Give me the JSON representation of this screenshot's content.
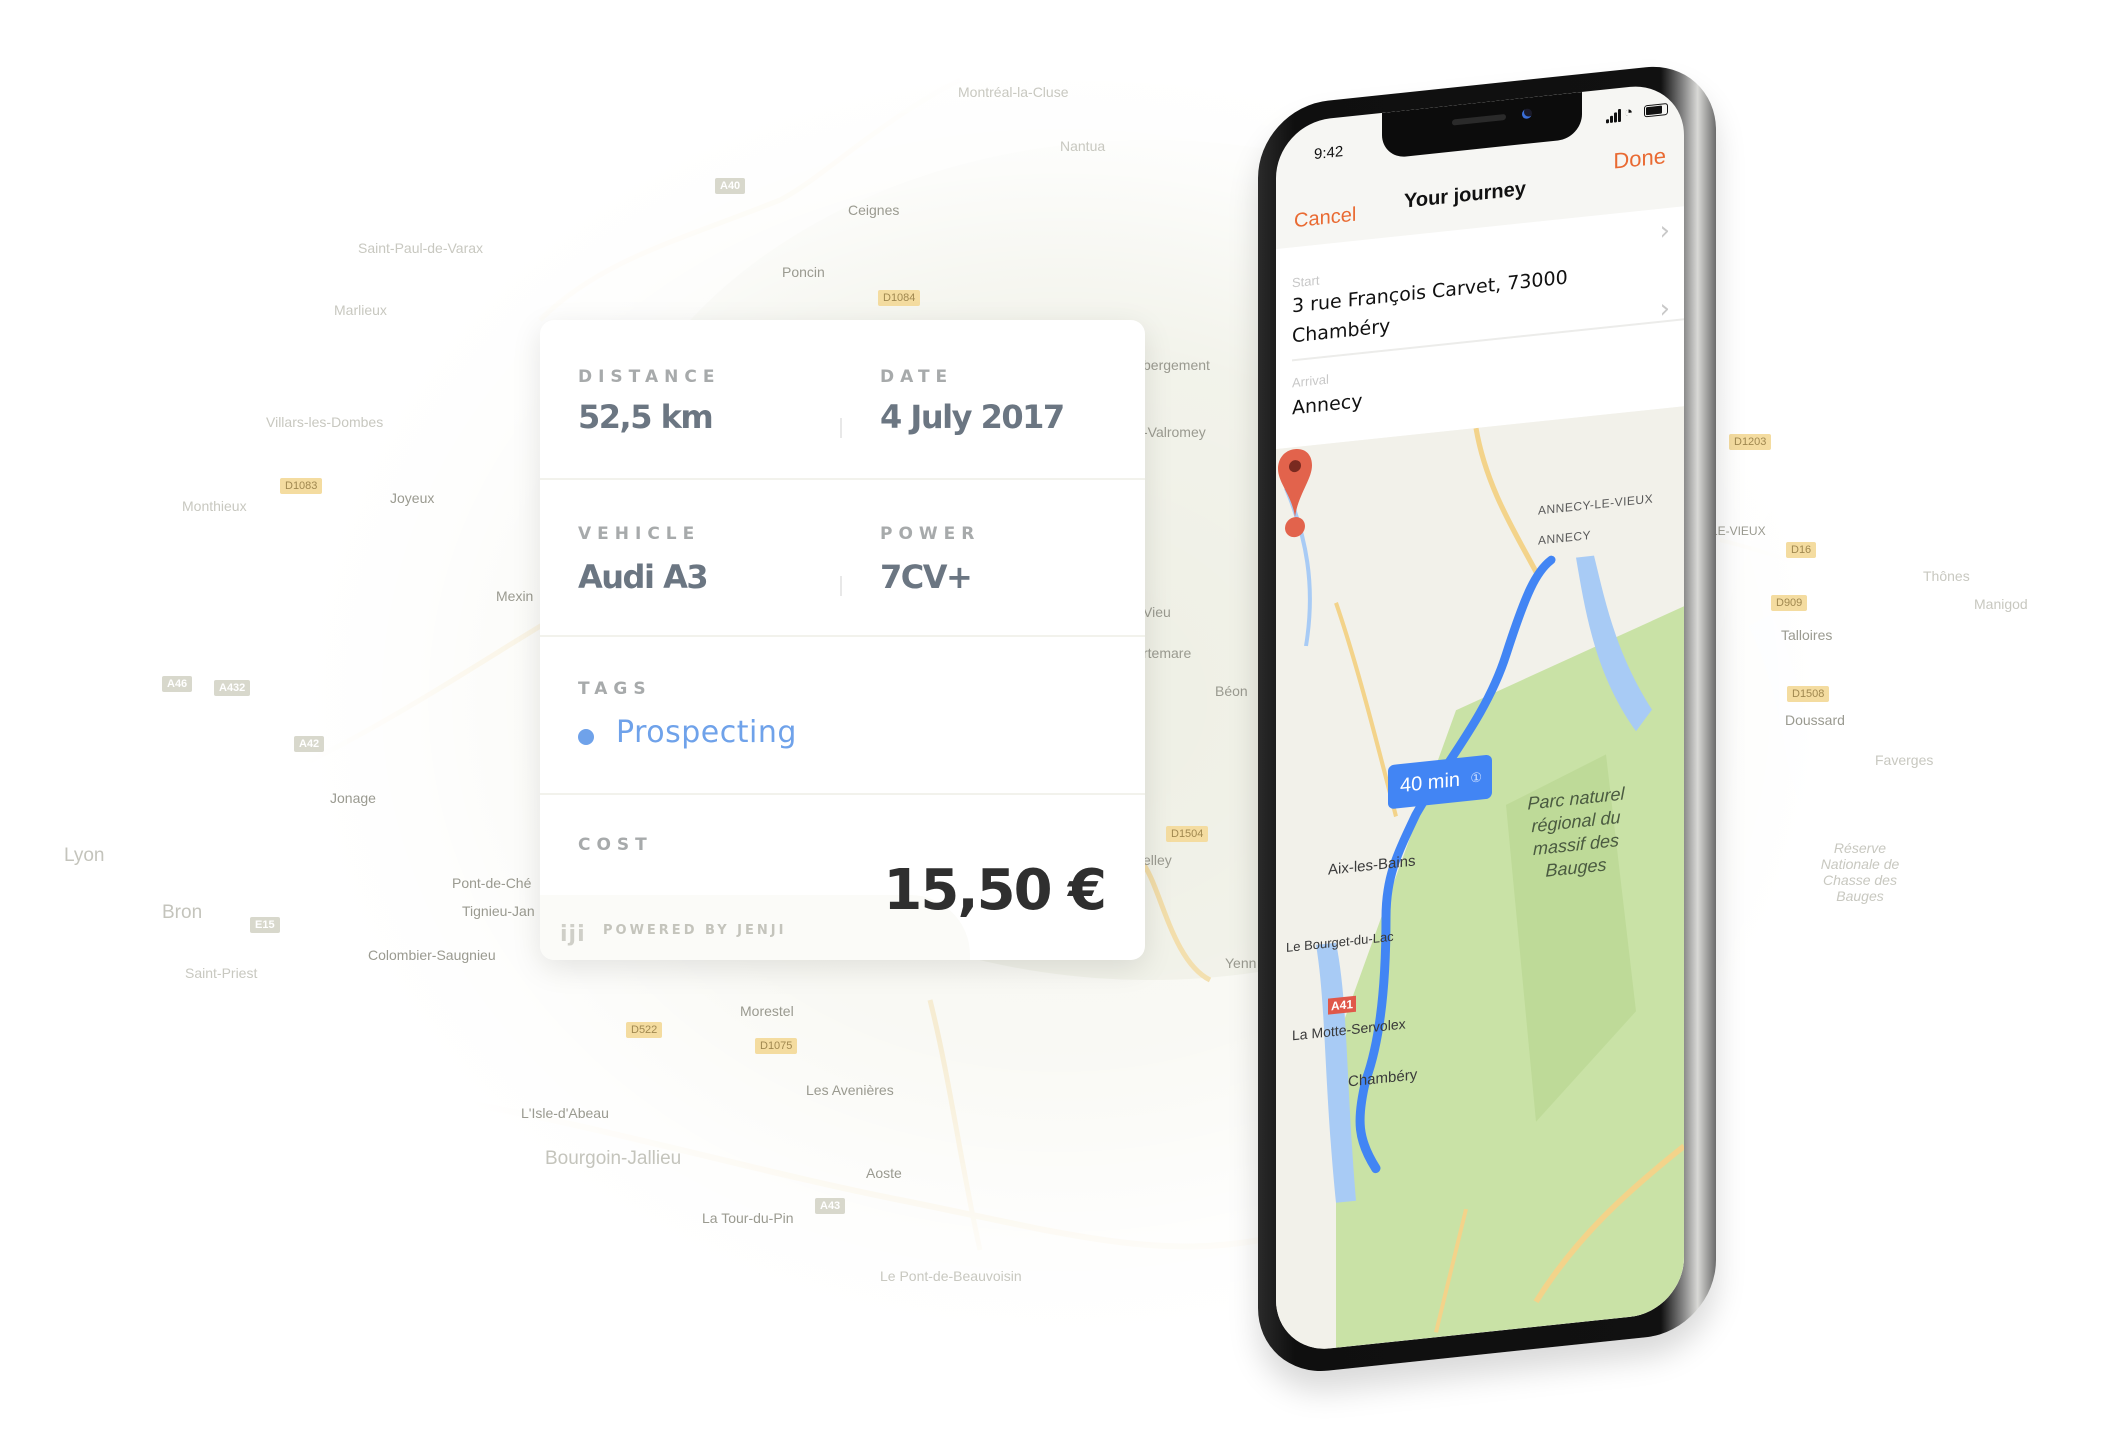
{
  "background_map": {
    "labels": [
      {
        "text": "Montréal-la-Cluse",
        "kind": "faint"
      },
      {
        "text": "Nantua",
        "kind": "faint"
      },
      {
        "text": "Ceignes",
        "kind": "normal"
      },
      {
        "text": "Poncin",
        "kind": "normal"
      },
      {
        "text": "Saint-Paul-de-Varax",
        "kind": "faint"
      },
      {
        "text": "Marlieux",
        "kind": "faint"
      },
      {
        "text": "Villars-les-Dombes",
        "kind": "faint"
      },
      {
        "text": "Monthieux",
        "kind": "faint"
      },
      {
        "text": "Joyeux",
        "kind": "normal"
      },
      {
        "text": "Mexin",
        "kind": "normal"
      },
      {
        "text": "Jonage",
        "kind": "normal"
      },
      {
        "text": "Lyon",
        "kind": "big"
      },
      {
        "text": "Bron",
        "kind": "big"
      },
      {
        "text": "Pont-de-Ché",
        "kind": "normal"
      },
      {
        "text": "Tignieu-Jan",
        "kind": "normal"
      },
      {
        "text": "Colombier-Saugnieu",
        "kind": "normal"
      },
      {
        "text": "Saint-Priest",
        "kind": "faint"
      },
      {
        "text": "Morestel",
        "kind": "normal"
      },
      {
        "text": "Les Avenières",
        "kind": "normal"
      },
      {
        "text": "L'Isle-d'Abeau",
        "kind": "normal"
      },
      {
        "text": "Bourgoin-Jallieu",
        "kind": "big"
      },
      {
        "text": "Aoste",
        "kind": "normal"
      },
      {
        "text": "La Tour-du-Pin",
        "kind": "normal"
      },
      {
        "text": "Le Pont-de-Beauvoisin",
        "kind": "faint"
      },
      {
        "text": "bergement",
        "kind": "normal"
      },
      {
        "text": "-Valromey",
        "kind": "normal"
      },
      {
        "text": "Vieu",
        "kind": "normal"
      },
      {
        "text": "rtemare",
        "kind": "normal"
      },
      {
        "text": "Béon",
        "kind": "normal"
      },
      {
        "text": "elley",
        "kind": "normal"
      },
      {
        "text": "Yenn",
        "kind": "normal"
      },
      {
        "text": "Thônes",
        "kind": "faint"
      },
      {
        "text": "Manigod",
        "kind": "faint"
      },
      {
        "text": "Talloires",
        "kind": "normal"
      },
      {
        "text": "Doussard",
        "kind": "normal"
      },
      {
        "text": "Faverges",
        "kind": "faint"
      },
      {
        "text": "Réserve Nationale de Chasse des Bauges",
        "kind": "faint"
      },
      {
        "text": "Y-LE-VIEUX",
        "kind": "normal"
      }
    ],
    "road_shields": [
      "A40",
      "D1084",
      "D1083",
      "A46",
      "A432",
      "A42",
      "E15",
      "D522",
      "D1075",
      "A43",
      "D1504",
      "D1203",
      "D16",
      "D909",
      "D1508"
    ]
  },
  "card": {
    "distance": {
      "label": "DISTANCE",
      "value": "52,5 km"
    },
    "date": {
      "label": "DATE",
      "value": "4 July 2017"
    },
    "vehicle": {
      "label": "VEHICLE",
      "value": "Audi A3"
    },
    "power": {
      "label": "POWER",
      "value": "7CV+"
    },
    "tags": {
      "label": "TAGS",
      "items": [
        {
          "text": "Prospecting",
          "color": "#6fa2ea"
        }
      ]
    },
    "cost": {
      "label": "COST",
      "value": "15,50 €"
    },
    "footer": {
      "logo": "iji",
      "text": "POWERED BY JENJI"
    }
  },
  "phone": {
    "status": {
      "time": "9:42",
      "icons": [
        "signal-icon",
        "wifi-icon",
        "battery-icon"
      ]
    },
    "nav": {
      "cancel": "Cancel",
      "title": "Your journey",
      "done": "Done",
      "accent": "#e96a32"
    },
    "start": {
      "label": "Start",
      "value": "3 rue François Carvet, 73000 Chambéry"
    },
    "arrival": {
      "label": "Arrival",
      "value": "Annecy"
    },
    "map": {
      "route_color": "#4285f4",
      "eta": "40 min",
      "road_badge": "A41",
      "labels": {
        "annecy_le_vieux": "ANNECY-LE-VIEUX",
        "annecy": "ANNECY",
        "aix": "Aix-les-Bains",
        "bourget": "Le Bourget-du-Lac",
        "motte": "La Motte-Servolex",
        "chambery": "Chambéry",
        "park": "Parc naturel régional du massif des Bauges"
      }
    }
  }
}
